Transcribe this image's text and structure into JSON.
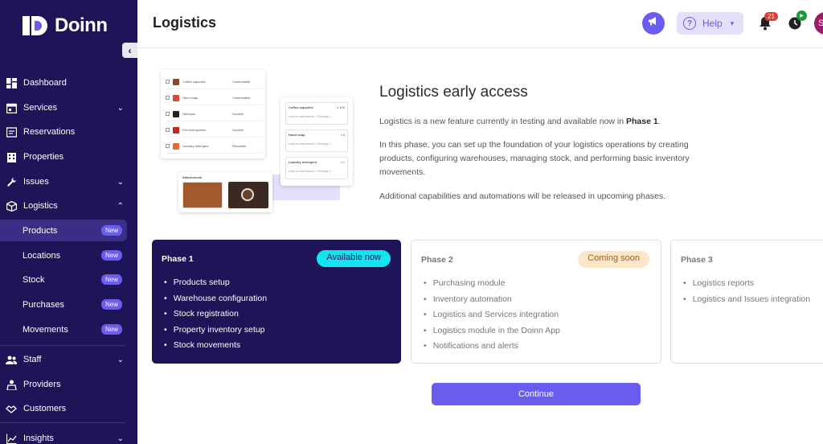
{
  "brand": {
    "name": "Doinn"
  },
  "header": {
    "title": "Logistics",
    "help_label": "Help",
    "notification_count": "21",
    "avatar_initial": "S"
  },
  "sidebar": {
    "items": [
      {
        "label": "Dashboard",
        "icon": "dashboard-icon"
      },
      {
        "label": "Services",
        "icon": "calendar-icon"
      },
      {
        "label": "Reservations",
        "icon": "reservations-icon"
      },
      {
        "label": "Properties",
        "icon": "building-icon"
      },
      {
        "label": "Issues",
        "icon": "wrench-icon"
      },
      {
        "label": "Logistics",
        "icon": "box-icon"
      },
      {
        "label": "Staff",
        "icon": "people-icon"
      },
      {
        "label": "Providers",
        "icon": "providers-icon"
      },
      {
        "label": "Customers",
        "icon": "handshake-icon"
      },
      {
        "label": "Insights",
        "icon": "chart-line-icon"
      }
    ],
    "logistics_sub": [
      {
        "label": "Products",
        "badge": "New"
      },
      {
        "label": "Locations",
        "badge": "New"
      },
      {
        "label": "Stock",
        "badge": "New"
      },
      {
        "label": "Purchases",
        "badge": "New"
      },
      {
        "label": "Movements",
        "badge": "New"
      }
    ]
  },
  "illustration": {
    "rows": [
      {
        "name": "Coffee capsules",
        "type": "Consumable"
      },
      {
        "name": "Hand soap",
        "type": "Consumable"
      },
      {
        "name": "Hairdryer",
        "type": "Durable"
      },
      {
        "name": "Fire extinguisher",
        "type": "Durable"
      },
      {
        "name": "Laundry detergent",
        "type": "Reusable"
      }
    ],
    "stock_cards": [
      {
        "name": "Coffee capsules",
        "qty": "x 100",
        "location": "Lisbon warehouse / Storage 1"
      },
      {
        "name": "Hand soap",
        "qty": "x 5",
        "location": "Lisbon warehouse / Storage 1"
      },
      {
        "name": "Laundry detergent",
        "qty": "x 1",
        "location": "Lisbon warehouse / Storage 1"
      }
    ],
    "attachments_label": "Attachments"
  },
  "intro": {
    "title": "Logistics early access",
    "p1_before": "Logistics is a new feature currently in testing and available now in ",
    "p1_bold": "Phase 1",
    "p1_after": ".",
    "p2": "In this phase, you can set up the foundation of your logistics operations by creating products, configuring warehouses, managing stock, and performing basic inventory movements.",
    "p3": "Additional capabilities and automations will be released in upcoming phases."
  },
  "phases": [
    {
      "title": "Phase 1",
      "badge": "Available now",
      "items": [
        "Products setup",
        "Warehouse configuration",
        "Stock registration",
        "Property inventory setup",
        "Stock movements"
      ]
    },
    {
      "title": "Phase 2",
      "badge": "Coming soon",
      "items": [
        "Purchasing module",
        "Inventory automation",
        "Logistics and Services integration",
        "Logistics module in the Doinn App",
        "Notifications and alerts"
      ]
    },
    {
      "title": "Phase 3",
      "items": [
        "Logistics reports",
        "Logistics and Issues integration"
      ]
    }
  ],
  "continue_label": "Continue",
  "colors": {
    "sidebar_bg": "#1e1458",
    "accent": "#6b5cf0",
    "available_badge": "#14e3f0",
    "soon_badge": "#fde7c8"
  }
}
